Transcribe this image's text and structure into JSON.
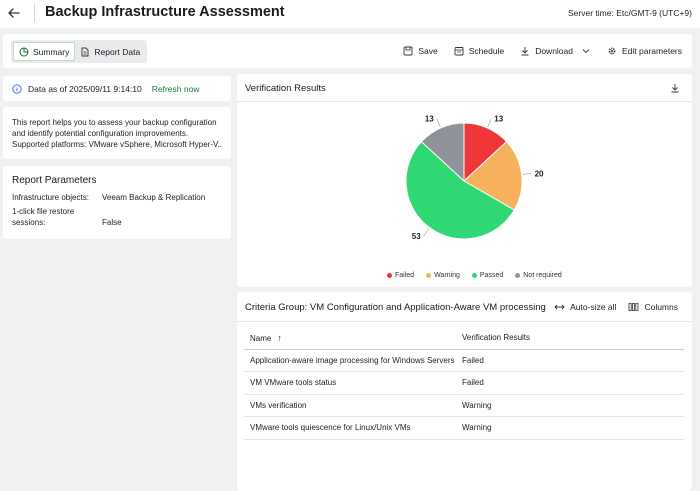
{
  "header": {
    "title": "Backup Infrastructure Assessment",
    "server_time": "Server time: Etc/GMT-9 (UTC+9)"
  },
  "tabs": [
    {
      "label": "Summary",
      "active": true,
      "icon": "summary-icon"
    },
    {
      "label": "Report Data",
      "active": false,
      "icon": "document-icon"
    }
  ],
  "actions": {
    "save": "Save",
    "schedule": "Schedule",
    "download": "Download",
    "edit_parameters": "Edit parameters"
  },
  "info": {
    "data_as_of": "Data as of 2025/09/11 9:14:10",
    "refresh": "Refresh now"
  },
  "description": {
    "line1": "This report helps you to assess your backup configuration",
    "line2": "and identify potential configuration improvements.",
    "line3": "Supported platforms: VMware vSphere, Microsoft Hyper-V..."
  },
  "parameters": {
    "title": "Report Parameters",
    "rows": [
      {
        "key": "Infrastructure objects:",
        "value": "Veeam Backup & Replication"
      },
      {
        "key": "1-click file restore",
        "key2": "sessions:",
        "value": "False"
      }
    ]
  },
  "verification": {
    "title": "Verification Results"
  },
  "chart_data": {
    "type": "pie",
    "categories": [
      "Failed",
      "Warning",
      "Passed",
      "Not required"
    ],
    "values": [
      13,
      20,
      53,
      13
    ],
    "colors": [
      "#ee3838",
      "#f7b05c",
      "#2fd873",
      "#8f9399"
    ],
    "legend": "bottom"
  },
  "criteria": {
    "title": "Criteria Group: VM Configuration and Application-Aware VM processing",
    "autosize": "Auto-size all",
    "columns": "Columns",
    "headers": [
      "Name",
      "Verification Results"
    ],
    "rows": [
      [
        "Application-aware image processing for Windows Servers",
        "Failed"
      ],
      [
        "VM VMware tools status",
        "Failed"
      ],
      [
        "VMs verification",
        "Warning"
      ],
      [
        "VMware tools quiescence for Linux/Unix VMs",
        "Warning"
      ]
    ]
  }
}
